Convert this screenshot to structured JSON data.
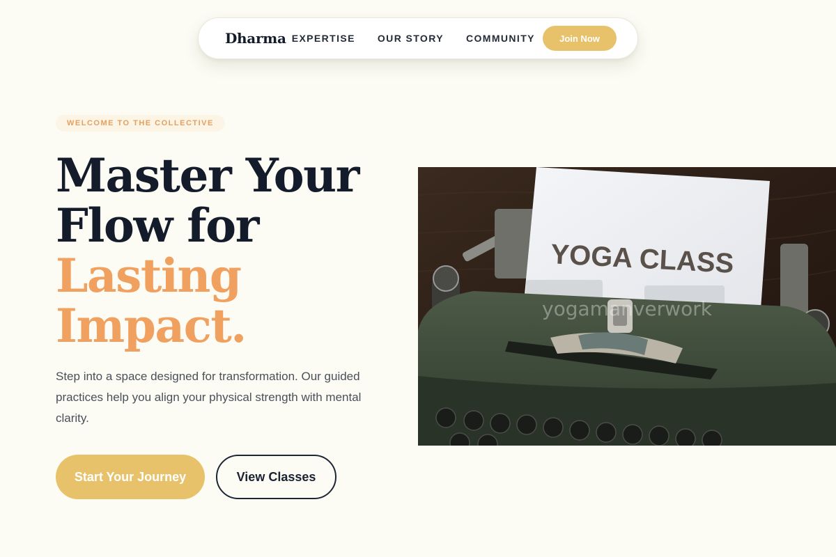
{
  "nav": {
    "brand": "Dharma",
    "links": [
      "EXPERTISE",
      "OUR STORY",
      "COMMUNITY"
    ],
    "join_label": "Join Now"
  },
  "hero": {
    "eyebrow": "WELCOME TO THE COLLECTIVE",
    "headline": {
      "line1": "Master Your",
      "line2": "Flow for",
      "accent_line1": "Lasting",
      "accent_line2": "Impact."
    },
    "subtext": "Step into a space designed for transformation. Our guided practices help you align your physical strength with mental clarity.",
    "primary_cta": "Start Your Journey",
    "secondary_cta": "View Classes",
    "image": {
      "paper_text": "YOGA CLASS",
      "watermark": "yogamanverwork"
    }
  },
  "colors": {
    "background": "#fdfcf4",
    "accent_gold": "#e8c26a",
    "accent_orange": "#f0a05f",
    "ink": "#141c2b"
  }
}
